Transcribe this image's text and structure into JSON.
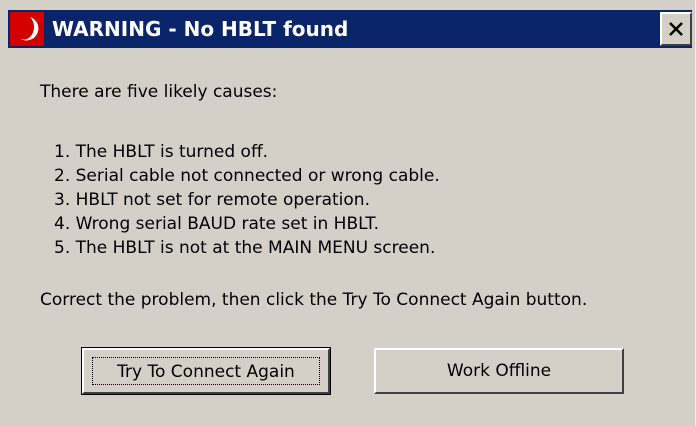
{
  "window": {
    "title": "WARNING - No HBLT found",
    "close_label": "X"
  },
  "message": {
    "intro": "There are five likely causes:",
    "causes": [
      "1. The HBLT is turned off.",
      "2. Serial cable not connected or wrong cable.",
      "3. HBLT not set for remote operation.",
      "4. Wrong serial BAUD rate set in HBLT.",
      "5. The HBLT is not at the MAIN MENU screen."
    ],
    "instruction": "Correct the problem, then click the Try To Connect Again button."
  },
  "buttons": {
    "retry_label": "Try To Connect Again",
    "offline_label": "Work Offline"
  },
  "colors": {
    "titlebar": "#0a246a",
    "dialog_bg": "#d4d0c8",
    "icon_red": "#d40000"
  },
  "icons": {
    "app_icon": "app-logo-icon",
    "close_icon": "close-icon"
  }
}
